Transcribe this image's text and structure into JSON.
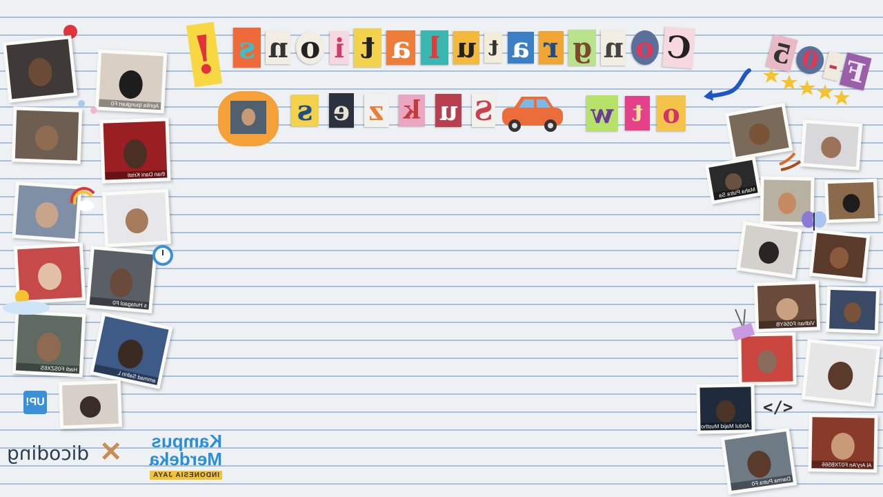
{
  "headline": {
    "line1": [
      "C",
      "o",
      "n",
      "g",
      "r",
      "a",
      "t",
      "u",
      "l",
      "a",
      "t",
      "i",
      "o",
      "n",
      "s"
    ],
    "line2": [
      "S",
      "u",
      "k",
      "z",
      "e",
      "s"
    ],
    "line3": [
      "o",
      "t",
      "w"
    ],
    "badge": [
      "F",
      "-",
      "0",
      "5"
    ]
  },
  "participants_left": [
    {
      "name": ""
    },
    {
      "name": "Aprilia Ipungkart F0"
    },
    {
      "name": ""
    },
    {
      "name": "than Dani Kristi"
    },
    {
      "name": ""
    },
    {
      "name": ""
    },
    {
      "name": ""
    },
    {
      "name": "s Hutagaol F0"
    },
    {
      "name": "Hadi F0SZX6S"
    },
    {
      "name": "ammad Safrin L"
    },
    {
      "name": ""
    }
  ],
  "participants_right": [
    {
      "name": ""
    },
    {
      "name": ""
    },
    {
      "name": "Maha Putra Sa"
    },
    {
      "name": ""
    },
    {
      "name": ""
    },
    {
      "name": ""
    },
    {
      "name": ""
    },
    {
      "name": ""
    },
    {
      "name": "Vidhari F056YB"
    },
    {
      "name": ""
    },
    {
      "name": ""
    },
    {
      "name": ""
    },
    {
      "name": "Abdul Majid Musthof"
    },
    {
      "name": "Darma Putra F0"
    },
    {
      "name": "Al Ary'An F07XB566"
    }
  ],
  "logos": {
    "up": "UP!",
    "dicoding": "dicoding",
    "x": "✕",
    "kampus_line1": "Kampus",
    "kampus_line2": "Merdeka",
    "kampus_line3": "INDONESIA JAYA"
  },
  "code_icon": "</>",
  "colors": {
    "paper": "#eef1f4",
    "rule": "#a9bfd8",
    "accent_orange": "#f4a13a",
    "accent_yellow": "#f7d842",
    "accent_blue": "#3a8fd6"
  }
}
